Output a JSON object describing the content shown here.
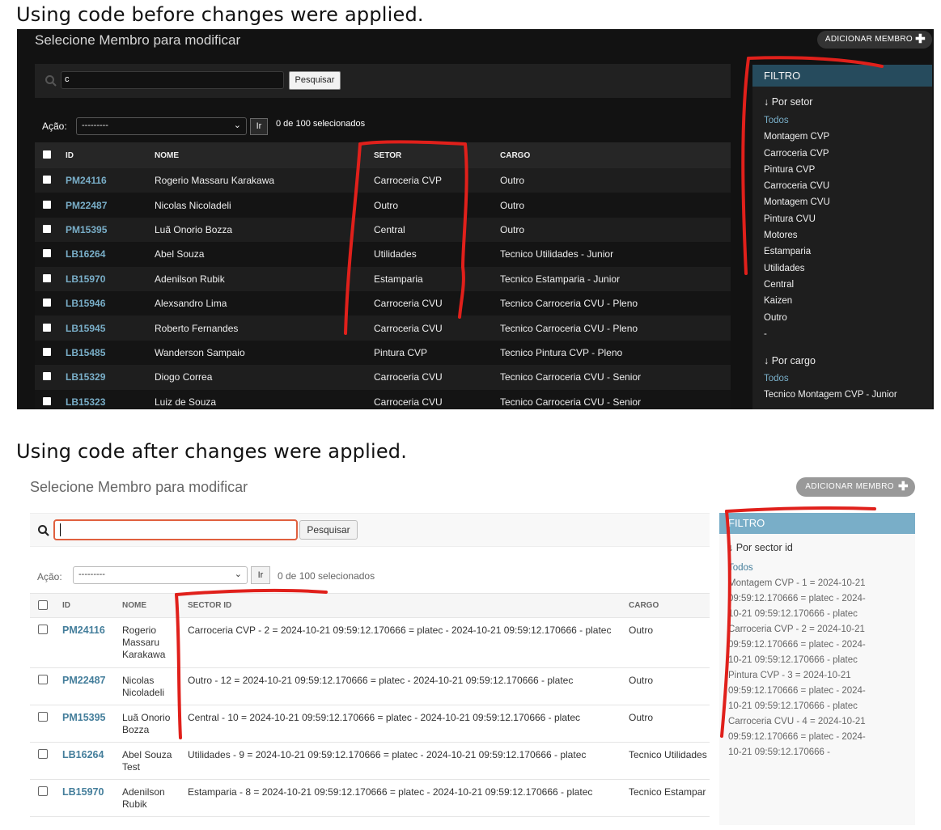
{
  "captions": {
    "before": "Using code before changes were applied.",
    "after": "Using code after changes were applied."
  },
  "icons": {
    "search": "search-icon",
    "add": "plus-icon",
    "dropdown": "chevron-down-icon",
    "sort": "down-arrow-icon"
  },
  "colors": {
    "annotation_red": "#e0201b",
    "dark_filter_header": "#264b5d",
    "light_filter_header": "#79aec8",
    "link_dark": "#79aec8",
    "link_light": "#447e9b",
    "focus_border": "#e0603f"
  },
  "before": {
    "title": "Selecione Membro para modificar",
    "add_button": "ADICIONAR MEMBRO",
    "search": {
      "value": "c",
      "button": "Pesquisar"
    },
    "actions": {
      "label": "Ação:",
      "selected": "---------",
      "go": "Ir",
      "count": "0 de 100 selecionados"
    },
    "columns": [
      "ID",
      "NOME",
      "SETOR",
      "CARGO"
    ],
    "rows": [
      {
        "id": "PM24116",
        "nome": "Rogerio Massaru Karakawa",
        "setor": "Carroceria CVP",
        "cargo": "Outro"
      },
      {
        "id": "PM22487",
        "nome": "Nicolas Nicoladeli",
        "setor": "Outro",
        "cargo": "Outro"
      },
      {
        "id": "PM15395",
        "nome": "Luã Onorio Bozza",
        "setor": "Central",
        "cargo": "Outro"
      },
      {
        "id": "LB16264",
        "nome": "Abel Souza",
        "setor": "Utilidades",
        "cargo": "Tecnico Utilidades - Junior"
      },
      {
        "id": "LB15970",
        "nome": "Adenilson Rubik",
        "setor": "Estamparia",
        "cargo": "Tecnico Estamparia - Junior"
      },
      {
        "id": "LB15946",
        "nome": "Alexsandro Lima",
        "setor": "Carroceria CVU",
        "cargo": "Tecnico Carroceria CVU - Pleno"
      },
      {
        "id": "LB15945",
        "nome": "Roberto Fernandes",
        "setor": "Carroceria CVU",
        "cargo": "Tecnico Carroceria CVU - Pleno"
      },
      {
        "id": "LB15485",
        "nome": "Wanderson Sampaio",
        "setor": "Pintura CVP",
        "cargo": "Tecnico Pintura CVP - Pleno"
      },
      {
        "id": "LB15329",
        "nome": "Diogo Correa",
        "setor": "Carroceria CVU",
        "cargo": "Tecnico Carroceria CVU - Senior"
      },
      {
        "id": "LB15323",
        "nome": "Luiz de Souza",
        "setor": "Carroceria CVU",
        "cargo": "Tecnico Carroceria CVU - Senior"
      }
    ],
    "filter": {
      "header": "FILTRO",
      "section1": "↓ Por setor",
      "items1": [
        "Todos",
        "Montagem CVP",
        "Carroceria CVP",
        "Pintura CVP",
        "Carroceria CVU",
        "Montagem CVU",
        "Pintura CVU",
        "Motores",
        "Estamparia",
        "Utilidades",
        "Central",
        "Kaizen",
        "Outro",
        "-"
      ],
      "section2": "↓ Por cargo",
      "items2": [
        "Todos",
        "Tecnico Montagem CVP - Junior"
      ]
    }
  },
  "after": {
    "title": "Selecione Membro para modificar",
    "add_button": "ADICIONAR MEMBRO",
    "search": {
      "value": "",
      "button": "Pesquisar"
    },
    "actions": {
      "label": "Ação:",
      "selected": "---------",
      "go": "Ir",
      "count": "0 de 100 selecionados"
    },
    "columns": [
      "ID",
      "NOME",
      "SECTOR ID",
      "CARGO"
    ],
    "rows": [
      {
        "id": "PM24116",
        "nome": "Rogerio Massaru Karakawa",
        "setor": "Carroceria CVP - 2 = 2024-10-21 09:59:12.170666 = platec - 2024-10-21 09:59:12.170666 - platec",
        "cargo": "Outro"
      },
      {
        "id": "PM22487",
        "nome": "Nicolas Nicoladeli",
        "setor": "Outro - 12 = 2024-10-21 09:59:12.170666 = platec - 2024-10-21 09:59:12.170666 - platec",
        "cargo": "Outro"
      },
      {
        "id": "PM15395",
        "nome": "Luã Onorio Bozza",
        "setor": "Central - 10 = 2024-10-21 09:59:12.170666 = platec - 2024-10-21 09:59:12.170666 - platec",
        "cargo": "Outro"
      },
      {
        "id": "LB16264",
        "nome": "Abel Souza Test",
        "setor": "Utilidades - 9 = 2024-10-21 09:59:12.170666 = platec - 2024-10-21 09:59:12.170666 - platec",
        "cargo": "Tecnico Utilidades"
      },
      {
        "id": "LB15970",
        "nome": "Adenilson Rubik",
        "setor": "Estamparia - 8 = 2024-10-21 09:59:12.170666 = platec - 2024-10-21 09:59:12.170666 - platec",
        "cargo": "Tecnico Estampar"
      }
    ],
    "filter": {
      "header": "FILTRO",
      "section1": "↓ Por sector id",
      "items1": [
        "Todos",
        "Montagem CVP - 1 = 2024-10-21 09:59:12.170666 = platec - 2024-10-21 09:59:12.170666 - platec",
        "Carroceria CVP - 2 = 2024-10-21 09:59:12.170666 = platec - 2024-10-21 09:59:12.170666 - platec",
        "Pintura CVP - 3 = 2024-10-21 09:59:12.170666 = platec - 2024-10-21 09:59:12.170666 - platec",
        "Carroceria CVU - 4 = 2024-10-21 09:59:12.170666 = platec - 2024-10-21 09:59:12.170666 -"
      ]
    }
  }
}
